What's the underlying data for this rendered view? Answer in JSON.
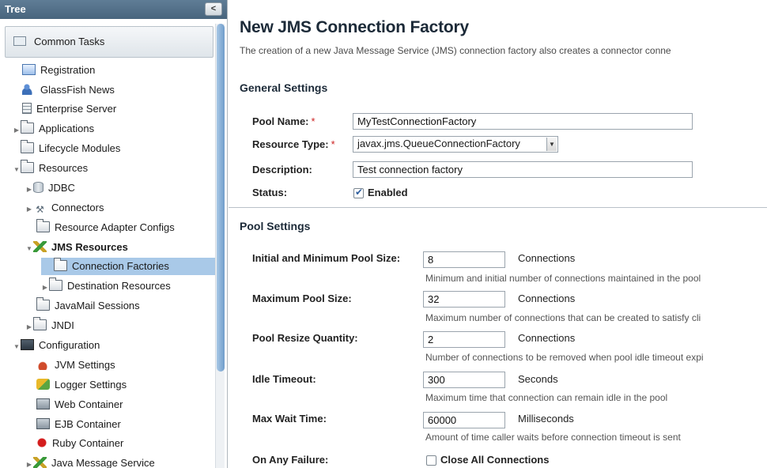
{
  "tree": {
    "header": "Tree",
    "collapse_label": "<",
    "common_tasks": "Common Tasks",
    "items": [
      {
        "label": "Registration"
      },
      {
        "label": "GlassFish News"
      },
      {
        "label": "Enterprise Server"
      },
      {
        "label": "Applications"
      },
      {
        "label": "Lifecycle Modules"
      },
      {
        "label": "Resources"
      },
      {
        "label": "JDBC"
      },
      {
        "label": "Connectors"
      },
      {
        "label": "Resource Adapter Configs"
      },
      {
        "label": "JMS Resources"
      },
      {
        "label": "Connection Factories"
      },
      {
        "label": "Destination Resources"
      },
      {
        "label": "JavaMail Sessions"
      },
      {
        "label": "JNDI"
      },
      {
        "label": "Configuration"
      },
      {
        "label": "JVM Settings"
      },
      {
        "label": "Logger Settings"
      },
      {
        "label": "Web Container"
      },
      {
        "label": "EJB Container"
      },
      {
        "label": "Ruby Container"
      },
      {
        "label": "Java Message Service"
      }
    ]
  },
  "page": {
    "title": "New JMS Connection Factory",
    "description": "The creation of a new Java Message Service (JMS) connection factory also creates a connector conne"
  },
  "general": {
    "title": "General Settings",
    "pool_name_label": "Pool Name:",
    "pool_name_value": "MyTestConnectionFactory",
    "resource_type_label": "Resource Type:",
    "resource_type_value": "javax.jms.QueueConnectionFactory",
    "required_mark": "*",
    "description_label": "Description:",
    "description_value": "Test connection factory",
    "status_label": "Status:",
    "status_enabled_label": "Enabled"
  },
  "pool": {
    "title": "Pool Settings",
    "initial_label": "Initial and Minimum Pool Size:",
    "initial_value": "8",
    "initial_unit": "Connections",
    "initial_help": "Minimum and initial number of connections maintained in the pool",
    "max_label": "Maximum Pool Size:",
    "max_value": "32",
    "max_unit": "Connections",
    "max_help": "Maximum number of connections that can be created to satisfy cli",
    "resize_label": "Pool Resize Quantity:",
    "resize_value": "2",
    "resize_unit": "Connections",
    "resize_help": "Number of connections to be removed when pool idle timeout expi",
    "idle_label": "Idle Timeout:",
    "idle_value": "300",
    "idle_unit": "Seconds",
    "idle_help": "Maximum time that connection can remain idle in the pool",
    "wait_label": "Max Wait Time:",
    "wait_value": "60000",
    "wait_unit": "Milliseconds",
    "wait_help": "Amount of time caller waits before connection timeout is sent",
    "failure_label": "On Any Failure:",
    "failure_option_label": "Close All Connections"
  }
}
